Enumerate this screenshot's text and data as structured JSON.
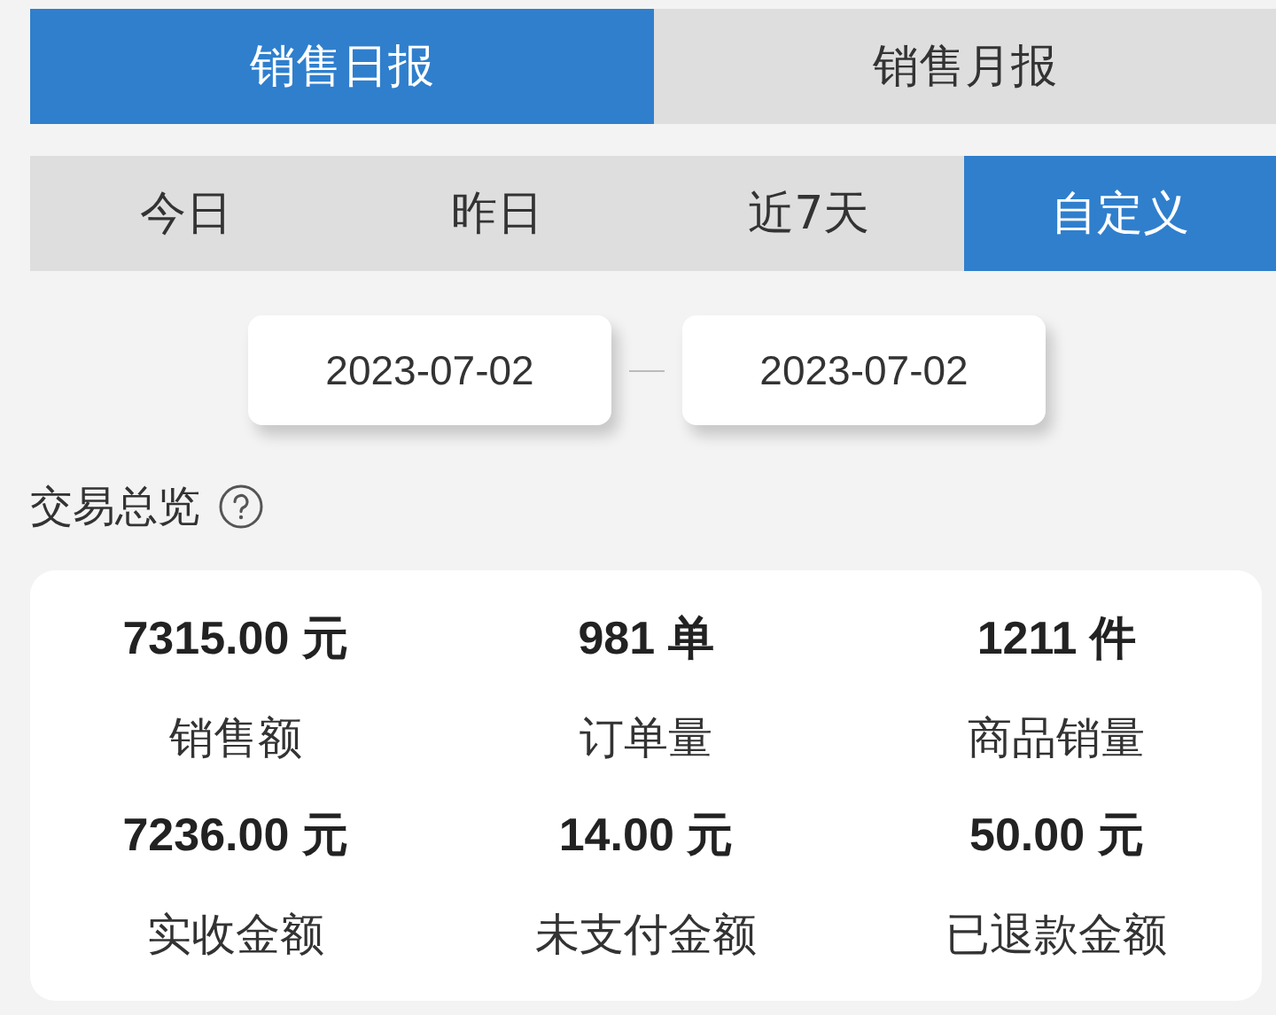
{
  "report_tabs": [
    {
      "label": "销售日报",
      "selected": true
    },
    {
      "label": "销售月报",
      "selected": false
    }
  ],
  "period_tabs": [
    {
      "label": "今日",
      "selected": false
    },
    {
      "label": "昨日",
      "selected": false
    },
    {
      "label": "近7天",
      "selected": false
    },
    {
      "label": "自定义",
      "selected": true
    }
  ],
  "date_range": {
    "start": "2023-07-02",
    "end": "2023-07-02"
  },
  "section_title": "交易总览",
  "metrics": [
    {
      "value": "7315.00 元",
      "label": "销售额"
    },
    {
      "value": "981 单",
      "label": "订单量"
    },
    {
      "value": "1211 件",
      "label": "商品销量"
    },
    {
      "value": "7236.00 元",
      "label": "实收金额"
    },
    {
      "value": "14.00 元",
      "label": "未支付金额"
    },
    {
      "value": "50.00 元",
      "label": "已退款金额"
    }
  ]
}
